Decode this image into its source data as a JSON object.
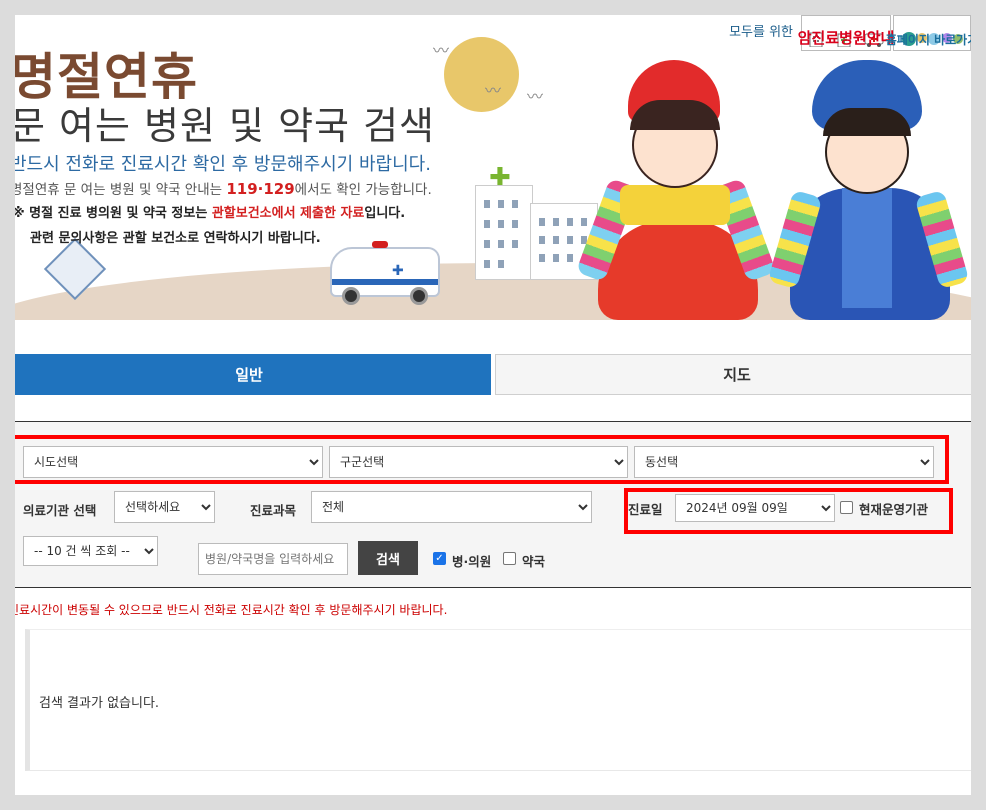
{
  "banner": {
    "title": "명절연휴",
    "subtitle": "문 여는 병원 및 약국 검색",
    "line1": "반드시 전화로 진료시간 확인 후 방문해주시기 바랍니다.",
    "line2_pre": "명절연휴 문 여는 병원 및 약국 안내는 ",
    "line2_hl": "119·129",
    "line2_post": "에서도 확인 가능합니다.",
    "line3_pre": "※ 명절 진료 병의원 및 약국 정보는 ",
    "line3_red": "관할보건소에서 제출한 자료",
    "line3_post": "입니다.",
    "line4": "관련 문의사항은 관할 보건소로 연락하시기 바랍니다."
  },
  "topbar": {
    "for_all": "모두를 위한",
    "cancer_hospital": "암진료병원안내",
    "homepage": "홈페이지 바로가기"
  },
  "tabs": [
    {
      "label": "일반",
      "active": true
    },
    {
      "label": "지도",
      "active": false
    }
  ],
  "filters": {
    "sido": "시도선택",
    "gugun": "구군선택",
    "dong": "동선택",
    "org_label": "의료기관 선택",
    "org_value": "선택하세요",
    "dept_label": "진료과목",
    "dept_value": "전체",
    "date_label": "진료일",
    "date_value": "2024년 09월 09일",
    "open_now_label": "현재운영기관",
    "open_now_checked": false,
    "per_page": "-- 10 건 씩 조회 --",
    "name_placeholder": "병원/약국명을 입력하세요",
    "search_button": "검색",
    "hospital_label": "병·의원",
    "hospital_checked": true,
    "pharmacy_label": "약국",
    "pharmacy_checked": false
  },
  "notice": "진료시간이 변동될 수 있으므로 반드시 전화로 진료시간 확인 후 방문해주시기 바랍니다.",
  "results": {
    "empty_message": "검색 결과가 없습니다."
  },
  "colors": {
    "tab_active": "#1f73be",
    "highlight_box": "#ff0000",
    "title": "#7a4a31",
    "info_blue": "#2d6aa3",
    "alert_red": "#d32020"
  }
}
